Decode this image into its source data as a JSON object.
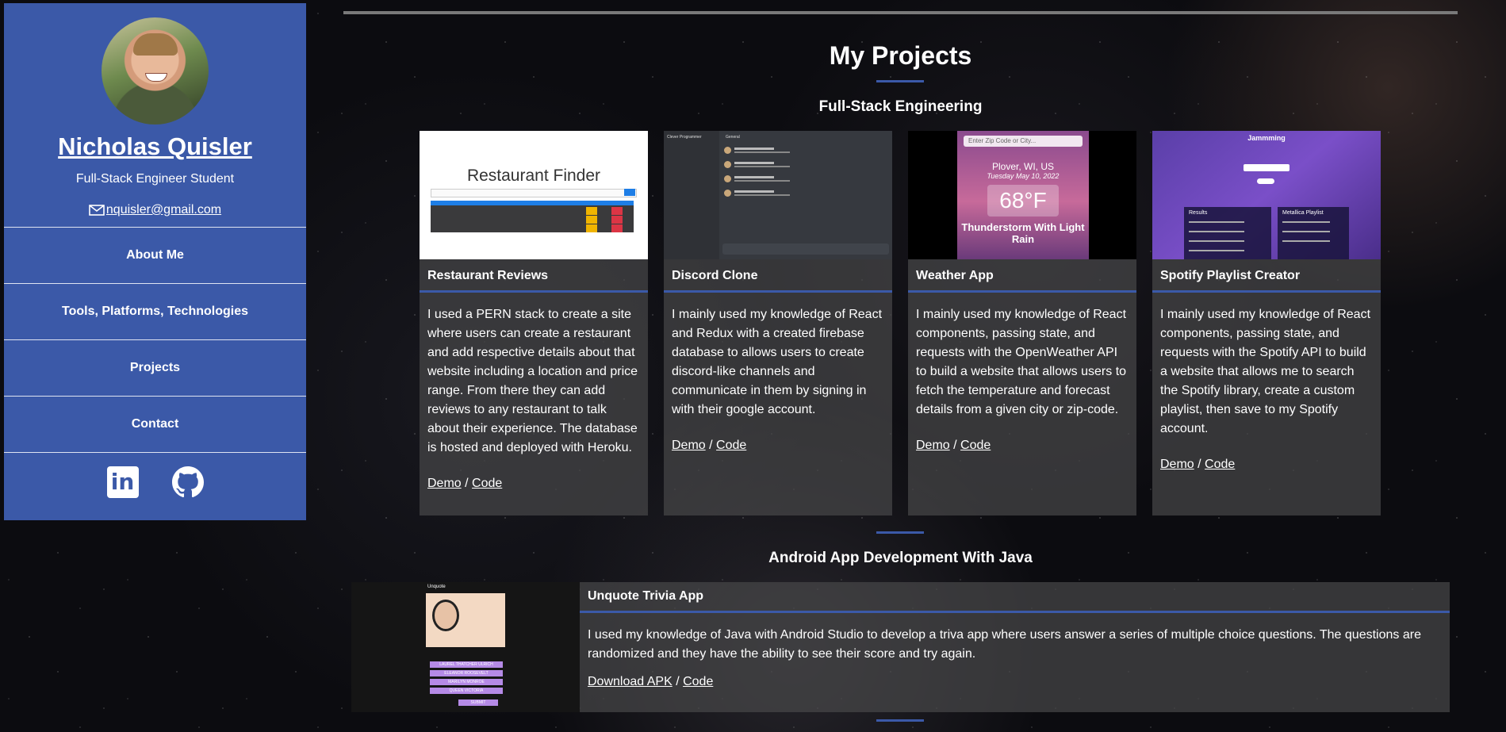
{
  "sidebar": {
    "name": "Nicholas Quisler",
    "role": "Full-Stack Engineer Student",
    "email": "nquisler@gmail.com",
    "nav": [
      "About Me",
      "Tools, Platforms, Technologies",
      "Projects",
      "Contact"
    ],
    "socials": {
      "linkedin": "in",
      "github_icon": "github-icon"
    }
  },
  "main": {
    "title": "My Projects",
    "sections": [
      {
        "heading": "Full-Stack Engineering",
        "projects": [
          {
            "title": "Restaurant Reviews",
            "description": "I used a PERN stack to create a site where users can create a restaurant and add respective details about that website including a location and price range. From there they can add reviews to any restaurant to talk about their experience. The database is hosted and deployed with Heroku.",
            "link1": "Demo",
            "sep": "/",
            "link2": "Code",
            "thumb": {
              "title": "Restaurant Finder"
            }
          },
          {
            "title": "Discord Clone",
            "description": "I mainly used my knowledge of React and Redux with a created firebase database to allows users to create discord-like channels and communicate in them by signing in with their google account.",
            "link1": "Demo",
            "sep": "/",
            "link2": "Code",
            "thumb": {
              "server": "Clever Programmer",
              "channel": "General"
            }
          },
          {
            "title": "Weather App",
            "description": "I mainly used my knowledge of React components, passing state, and requests with the OpenWeather API to build a website that allows users to fetch the temperature and forecast details from a given city or zip-code.",
            "link1": "Demo",
            "sep": "/",
            "link2": "Code",
            "thumb": {
              "input": "Enter Zip Code or City...",
              "location": "Plover, WI, US",
              "date": "Tuesday May 10, 2022",
              "temp": "68°F",
              "condition": "Thunderstorm With Light Rain"
            }
          },
          {
            "title": "Spotify Playlist Creator",
            "description": "I mainly used my knowledge of React components, passing state, and requests with the Spotify API to build a website that allows me to search the Spotify library, create a custom playlist, then save to my Spotify account.",
            "link1": "Demo",
            "sep": "/",
            "link2": "Code",
            "thumb": {
              "logo": "Jammming",
              "results": "Results",
              "playlist": "Metallica Playlist"
            }
          }
        ]
      },
      {
        "heading": "Android App Development With Java",
        "projects": [
          {
            "title": "Unquote Trivia App",
            "description": "I used my knowledge of Java with Android Studio to develop a triva app where users answer a series of multiple choice questions. The questions are randomized and they have the ability to see their score and try again.",
            "link1": "Download APK",
            "sep": "/",
            "link2": "Code",
            "thumb": {
              "app": "Unquote",
              "options": [
                "LAUREL THATCHER ULRICH",
                "ELEANOR ROOSEVELT",
                "MARILYN MONROE",
                "QUEEN VICTORIA"
              ],
              "submit": "SUBMIT"
            }
          }
        ]
      }
    ]
  },
  "colors": {
    "accent": "#3b59a8",
    "card": "#464648"
  }
}
